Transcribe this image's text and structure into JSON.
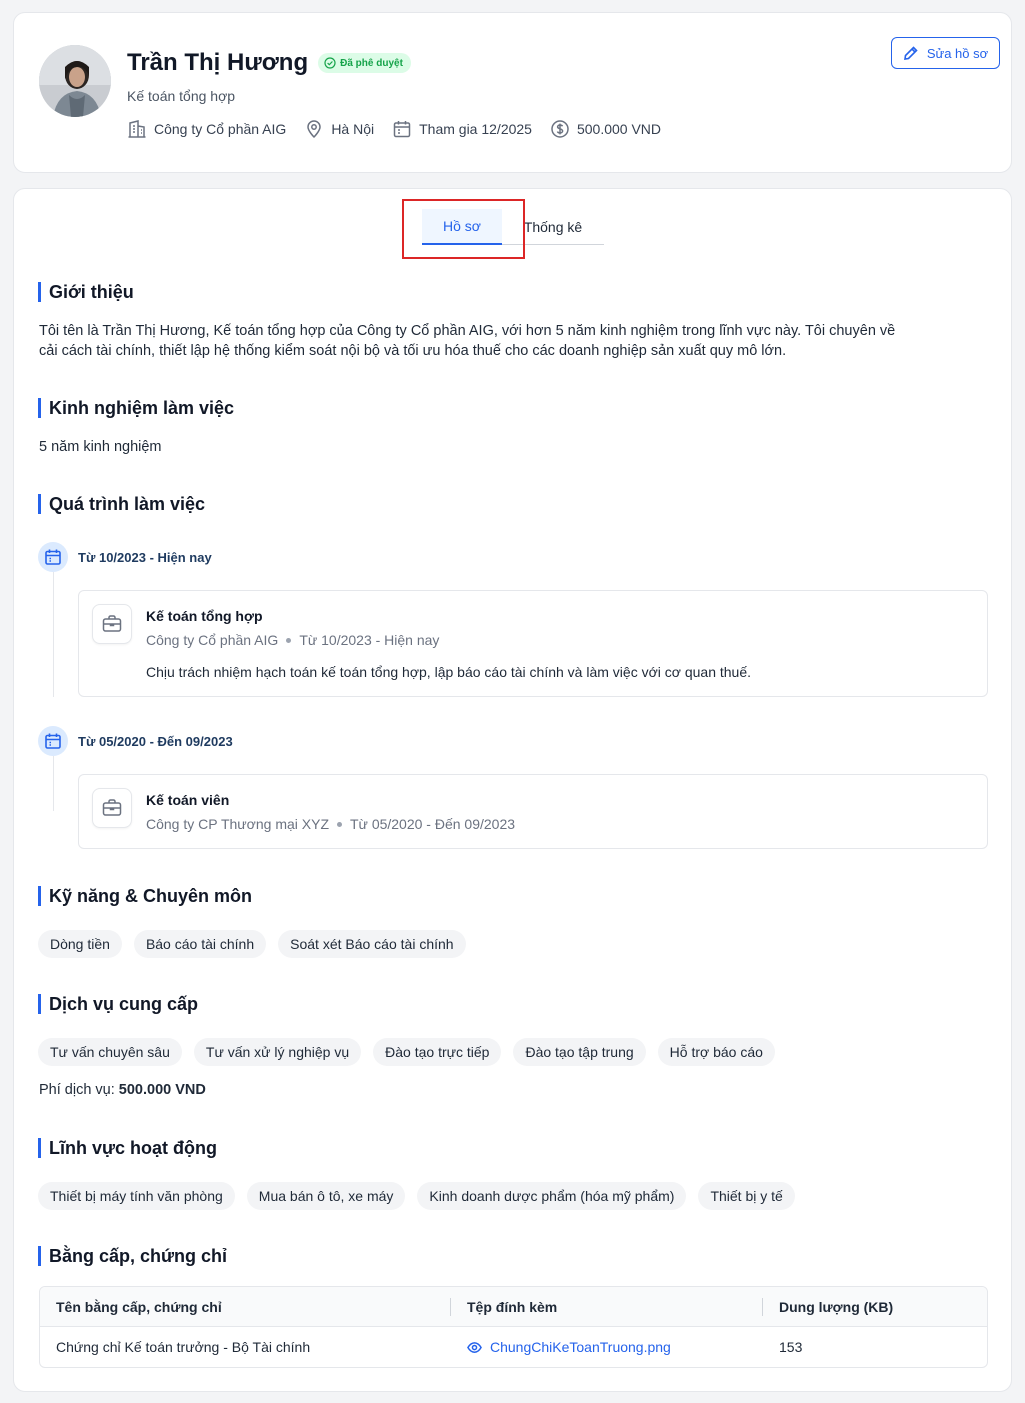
{
  "profile": {
    "name": "Trần Thị Hương",
    "status_badge": "Đã phê duyệt",
    "job_title": "Kế toán tổng hợp",
    "company": "Công ty Cổ phần AIG",
    "location": "Hà Nội",
    "joined": "Tham gia 12/2025",
    "fee": "500.000 VND",
    "edit_label": "Sửa hồ sơ"
  },
  "tabs": [
    {
      "label": "Hồ sơ",
      "active": true
    },
    {
      "label": "Thống kê",
      "active": false
    }
  ],
  "intro": {
    "title": "Giới thiệu",
    "line1": "Tôi tên là Trần Thị Hương, Kế toán tổng hợp của Công ty Cổ phần AIG, với hơn 5 năm kinh nghiệm trong lĩnh vực này. Tôi chuyên về",
    "line2": "cải cách tài chính, thiết lập hệ thống kiểm soát nội bộ và tối ưu hóa thuế cho các doanh nghiệp sản xuất quy mô lớn."
  },
  "experience": {
    "title": "Kinh nghiệm làm việc",
    "text": "5 năm kinh nghiệm"
  },
  "history": {
    "title": "Quá trình làm việc",
    "items": [
      {
        "period": "Từ 10/2023 - Hiện nay",
        "role": "Kế toán tổng hợp",
        "company": "Công ty Cổ phần AIG",
        "range": "Từ 10/2023 - Hiện nay",
        "description": "Chịu trách nhiệm hạch toán kế toán tổng hợp, lập báo cáo tài chính và làm việc với cơ quan thuế."
      },
      {
        "period": "Từ 05/2020 - Đến 09/2023",
        "role": "Kế toán viên",
        "company": "Công ty CP Thương mại XYZ",
        "range": "Từ 05/2020 - Đến 09/2023"
      }
    ]
  },
  "skills": {
    "title": "Kỹ năng & Chuyên môn",
    "items": [
      "Dòng tiền",
      "Báo cáo tài chính",
      "Soát xét Báo cáo tài chính"
    ]
  },
  "services": {
    "title": "Dịch vụ cung cấp",
    "items": [
      "Tư vấn chuyên sâu",
      "Tư vấn xử lý nghiệp vụ",
      "Đào tạo trực tiếp",
      "Đào tạo tập trung",
      "Hỗ trợ báo cáo"
    ],
    "fee_label": "Phí dịch vụ:",
    "fee_value": "500.000 VND"
  },
  "fields": {
    "title": "Lĩnh vực hoạt động",
    "items": [
      "Thiết bị máy tính văn phòng",
      "Mua bán ô tô, xe máy",
      "Kinh doanh dược phẩm (hóa mỹ phẩm)",
      "Thiết bị y tế"
    ]
  },
  "certificates": {
    "title": "Bằng cấp, chứng chỉ",
    "headers": [
      "Tên bằng cấp, chứng chỉ",
      "Tệp đính kèm",
      "Dung lượng (KB)"
    ],
    "rows": [
      {
        "name": "Chứng chỉ Kế toán trưởng - Bộ Tài chính",
        "file": "ChungChiKeToanTruong.png",
        "size": "153"
      }
    ]
  },
  "colors": {
    "accent": "#2563eb",
    "badge_green": "#16a34a",
    "highlight_red": "#dc2626"
  }
}
